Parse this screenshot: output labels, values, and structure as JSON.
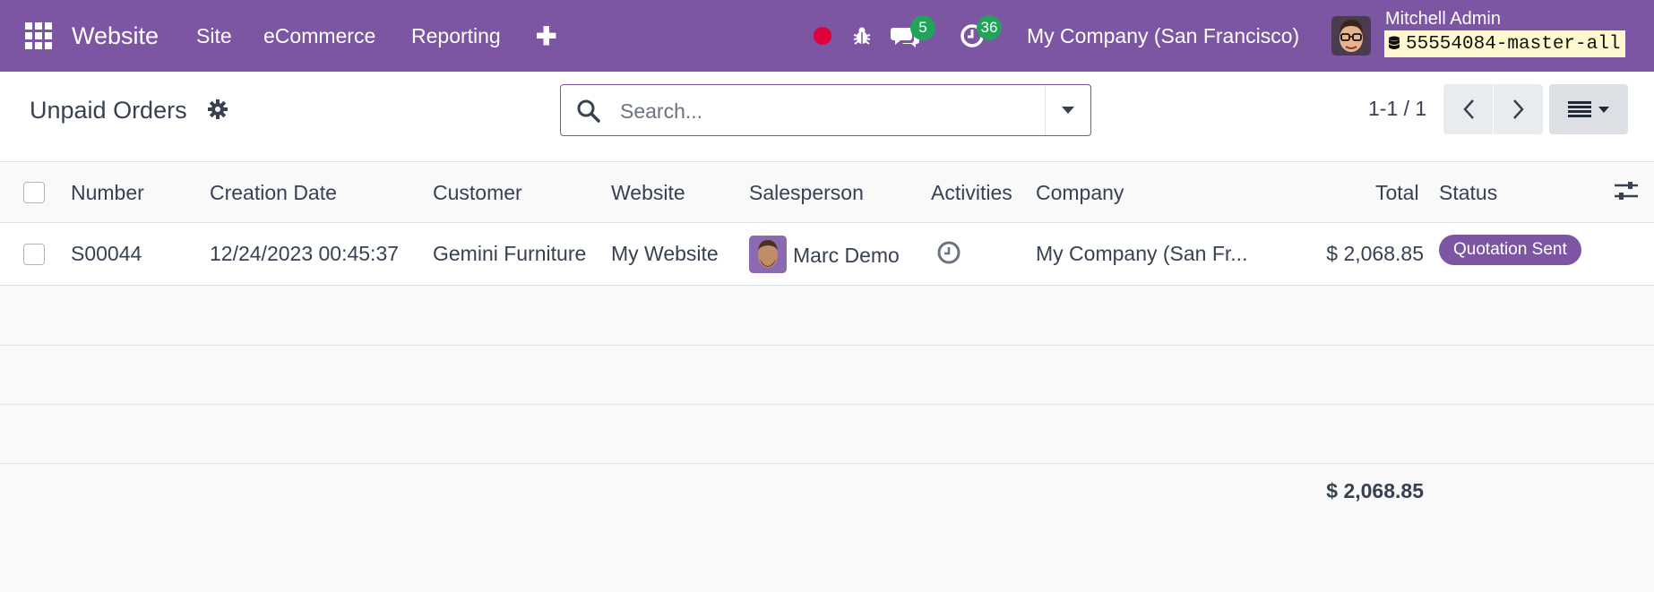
{
  "navbar": {
    "app_title": "Website",
    "menus": [
      "Site",
      "eCommerce",
      "Reporting"
    ],
    "plus": "✚",
    "messages_count": "5",
    "activities_count": "36",
    "company": "My Company (San Francisco)",
    "user_name": "Mitchell Admin",
    "database": "55554084-master-all",
    "colors": {
      "bar": "#7c55a3",
      "badge": "#21a35b",
      "recording": "#e0003c"
    }
  },
  "control_panel": {
    "title": "Unpaid Orders",
    "search_placeholder": "Search...",
    "pager": "1-1 / 1"
  },
  "table": {
    "columns": [
      "Number",
      "Creation Date",
      "Customer",
      "Website",
      "Salesperson",
      "Activities",
      "Company",
      "Total",
      "Status"
    ],
    "rows": [
      {
        "number": "S00044",
        "creation_date": "12/24/2023 00:45:37",
        "customer": "Gemini Furniture",
        "website": "My Website",
        "salesperson": "Marc Demo",
        "company": "My Company (San Fr...",
        "total": "$ 2,068.85",
        "status": "Quotation Sent"
      }
    ],
    "footer_total": "$ 2,068.85"
  }
}
